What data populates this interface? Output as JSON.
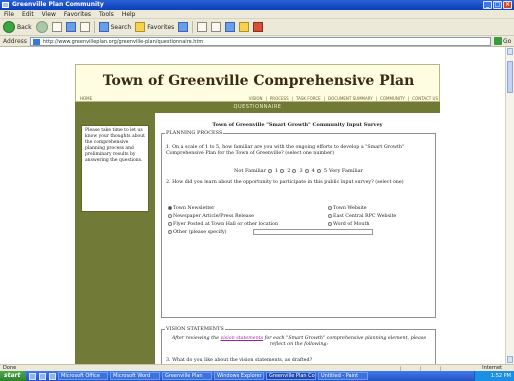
{
  "window": {
    "title": "Greenville Plan Community",
    "menu": [
      "File",
      "Edit",
      "View",
      "Favorites",
      "Tools",
      "Help"
    ]
  },
  "toolbar": {
    "back_label": "Back",
    "search_label": "Search",
    "favorites_label": "Favorites"
  },
  "address": {
    "label": "Address",
    "url": "http://www.greenvilleplan.org/greenville-plan/questionnaire.htm",
    "go_label": "Go"
  },
  "page": {
    "site_title": "Town of Greenville Comprehensive Plan",
    "nav_home": "HOME",
    "nav_links": [
      "VISION",
      "PROCESS",
      "TASK FORCE",
      "DOCUMENT SUMMARY",
      "COMMUNITY",
      "CONTACT US"
    ],
    "band_label": "QUESTIONNAIRE",
    "side_note": "Please take time to let us know your thoughts about the comprehensive planning process and preliminary results by answering the questions.",
    "survey_title": "Town of Greenville \"Smart Growth\" Community Input Survey",
    "section1": {
      "legend": "PLANNING PROCESS",
      "q1": "1. On a scale of 1 to 5, how familiar are you with the ongoing efforts to develop a \"Smart Growth\" Comprehensive Plan for the Town of Greenville? (select one number)",
      "scale_left": "Not Familiar",
      "scale_values": [
        "1",
        "2",
        "3",
        "4",
        "5"
      ],
      "scale_right": "Very Familiar",
      "q2": "2. How did you learn about the opportunity to participate in this public input survey? (select one)",
      "options": [
        "Town Newsletter",
        "Newspaper Article/Press Release",
        "Flyer Posted at Town Hall or other location",
        "Other (please specify)",
        "Town Website",
        "East Central RPC Website",
        "Word of Mouth"
      ]
    },
    "section2": {
      "legend": "VISION STATEMENTS",
      "instr_pre": "After reviewing the",
      "instr_link": "vision statements",
      "instr_post": "for each \"Smart Growth\" comprehensive planning element, please reflect on the following:",
      "q3": "3. What do you like about the vision statements, as drafted?"
    }
  },
  "status": {
    "text": "Done",
    "zone": "Internet"
  },
  "taskbar": {
    "start_label": "start",
    "tasks": [
      "Microsoft Office",
      "Microsoft Word",
      "Greenville Plan",
      "Windows Explorer",
      "Greenville Plan Com...",
      "Untitled - Paint"
    ],
    "clock": "1:52 PM"
  }
}
